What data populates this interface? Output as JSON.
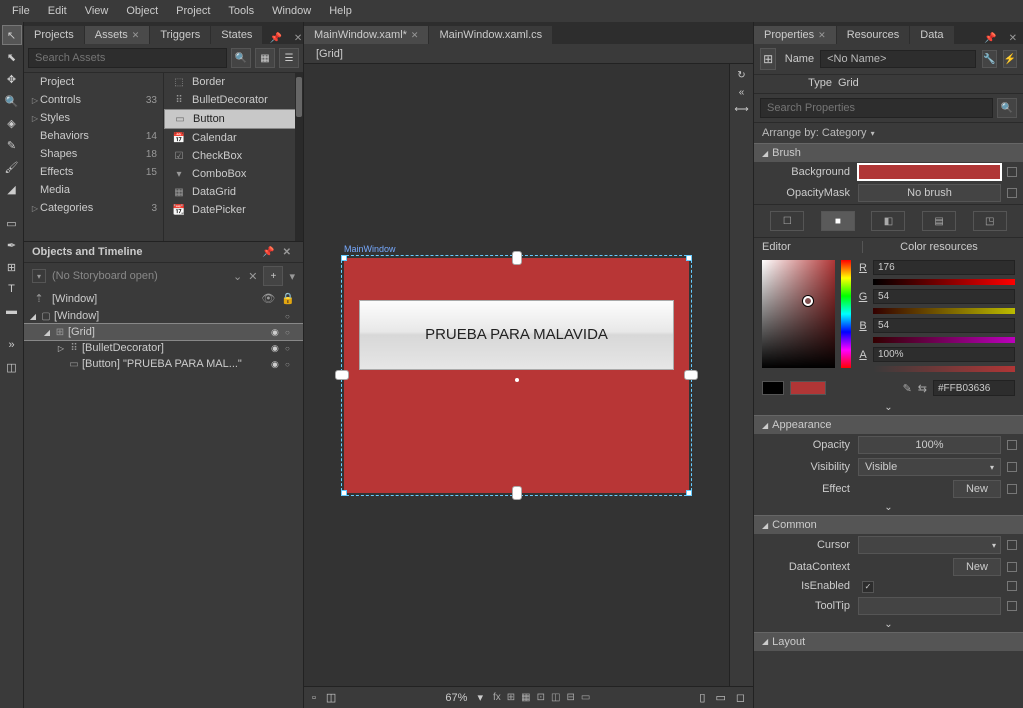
{
  "menu": [
    "File",
    "Edit",
    "View",
    "Object",
    "Project",
    "Tools",
    "Window",
    "Help"
  ],
  "leftPanel": {
    "tabs": [
      "Projects",
      "Assets",
      "Triggers",
      "States"
    ],
    "activeTab": 1,
    "searchPlaceholder": "Search Assets",
    "categories": [
      {
        "arrow": "",
        "name": "Project",
        "count": ""
      },
      {
        "arrow": "▷",
        "name": "Controls",
        "count": "33"
      },
      {
        "arrow": "▷",
        "name": "Styles",
        "count": ""
      },
      {
        "arrow": "",
        "name": "Behaviors",
        "count": "14"
      },
      {
        "arrow": "",
        "name": "Shapes",
        "count": "18"
      },
      {
        "arrow": "",
        "name": "Effects",
        "count": "15"
      },
      {
        "arrow": "",
        "name": "Media",
        "count": ""
      },
      {
        "arrow": "▷",
        "name": "Categories",
        "count": "3"
      }
    ],
    "controls": [
      "Border",
      "BulletDecorator",
      "Button",
      "Calendar",
      "CheckBox",
      "ComboBox",
      "DataGrid",
      "DatePicker"
    ],
    "controlSelected": 2
  },
  "timeline": {
    "header": "Objects and Timeline",
    "storyboard": "(No Storyboard open)",
    "topNode": "[Window]",
    "tree": [
      {
        "depth": 0,
        "arrow": "◢",
        "icon": "▢",
        "name": "[Window]",
        "eye": "",
        "sel": false
      },
      {
        "depth": 1,
        "arrow": "◢",
        "icon": "⊞",
        "name": "[Grid]",
        "eye": "◉",
        "sel": true
      },
      {
        "depth": 2,
        "arrow": "▷",
        "icon": "⠿",
        "name": "[BulletDecorator]",
        "eye": "◉",
        "sel": false
      },
      {
        "depth": 2,
        "arrow": "",
        "icon": "▭",
        "name": "[Button] \"PRUEBA PARA MAL...\"",
        "eye": "◉",
        "sel": false
      }
    ]
  },
  "docs": {
    "tabs": [
      {
        "name": "MainWindow.xaml*",
        "active": true
      },
      {
        "name": "MainWindow.xaml.cs",
        "active": false
      }
    ],
    "breadcrumb": "[Grid]"
  },
  "artboard": {
    "title": "MainWindow",
    "buttonText": "PRUEBA PARA MALAVIDA"
  },
  "status": {
    "zoom": "67%"
  },
  "props": {
    "tabs": [
      "Properties",
      "Resources",
      "Data"
    ],
    "activeTab": 0,
    "nameLabel": "Name",
    "nameValue": "<No Name>",
    "typeLabel": "Type",
    "typeValue": "Grid",
    "searchPlaceholder": "Search Properties",
    "arrangeLabel": "Arrange by: Category",
    "brush": {
      "header": "Brush",
      "backgroundLabel": "Background",
      "backgroundColor": "#b03636",
      "opacityMaskLabel": "OpacityMask",
      "opacityMaskValue": "No brush",
      "editorLabel": "Editor",
      "resourcesLabel": "Color resources",
      "r": "176",
      "g": "54",
      "b": "54",
      "a": "100%",
      "hex": "#FFB03636"
    },
    "appearance": {
      "header": "Appearance",
      "opacityLabel": "Opacity",
      "opacityValue": "100%",
      "visibilityLabel": "Visibility",
      "visibilityValue": "Visible",
      "effectLabel": "Effect",
      "effectValue": "New"
    },
    "common": {
      "header": "Common",
      "cursorLabel": "Cursor",
      "dataContextLabel": "DataContext",
      "dataContextValue": "New",
      "isEnabledLabel": "IsEnabled",
      "toolTipLabel": "ToolTip"
    },
    "layout": {
      "header": "Layout"
    }
  }
}
